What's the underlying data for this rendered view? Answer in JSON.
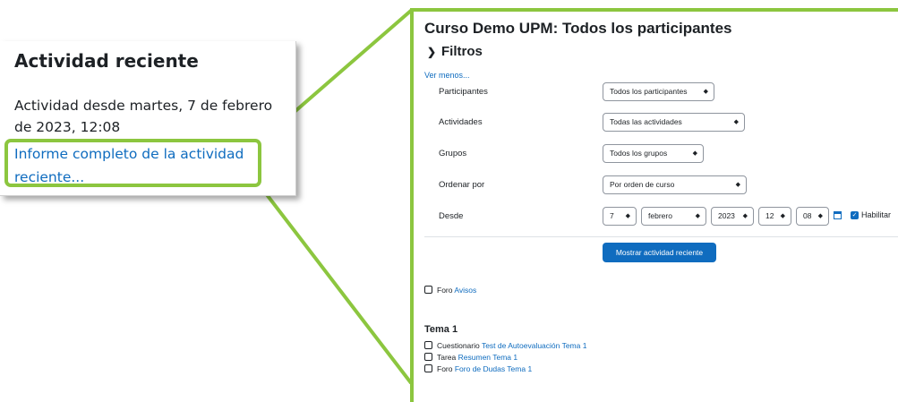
{
  "left_card": {
    "title": "Actividad reciente",
    "since_text": "Actividad desde martes, 7 de febrero de 2023, 12:08",
    "full_report_link": "Informe completo de la actividad reciente..."
  },
  "report": {
    "title": "Curso Demo UPM: Todos los participantes",
    "filters_heading": "Filtros",
    "toggle_link": "Ver menos...",
    "filters": {
      "participants_label": "Participantes",
      "participants_value": "Todos los participantes",
      "activities_label": "Actividades",
      "activities_value": "Todas las actividades",
      "groups_label": "Grupos",
      "groups_value": "Todos los grupos",
      "order_label": "Ordenar por",
      "order_value": "Por orden de curso",
      "since_label": "Desde",
      "day": "7",
      "month": "febrero",
      "year": "2023",
      "hour": "12",
      "minute": "08",
      "enable_label": "Habilitar"
    },
    "submit_button": "Mostrar actividad reciente",
    "activities": {
      "foro_avisos_type": "Foro",
      "foro_avisos_link": "Avisos",
      "section_title": "Tema 1",
      "items": [
        {
          "type": "Cuestionario",
          "link": "Test de Autoevaluación Tema 1",
          "icon": "quiz-icon"
        },
        {
          "type": "Tarea",
          "link": "Resumen Tema 1",
          "icon": "assignment-icon"
        },
        {
          "type": "Foro",
          "link": "Foro de Dudas Tema 1",
          "icon": "forum-icon"
        }
      ]
    }
  },
  "colors": {
    "highlight": "#8cc63f",
    "link": "#0f6cbf",
    "button": "#0f6cbf"
  }
}
